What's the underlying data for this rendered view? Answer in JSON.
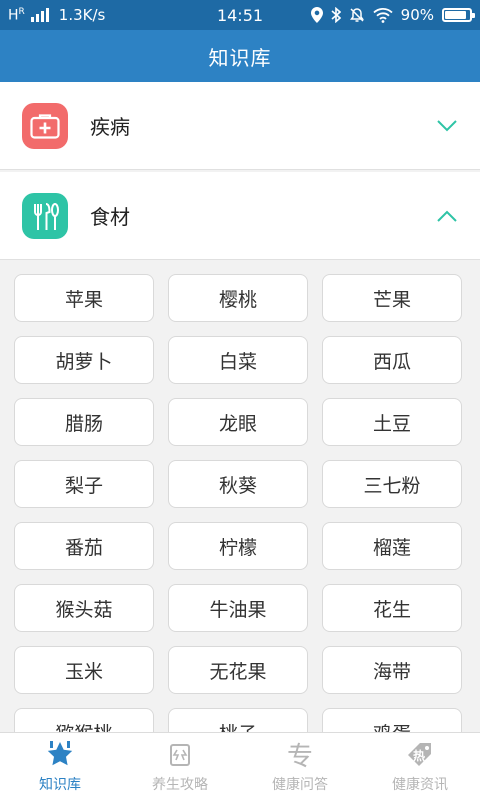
{
  "status_bar": {
    "network": "H",
    "network_sub": "R",
    "speed": "1.3K/s",
    "time": "14:51",
    "battery_percent": 90,
    "battery_label": "90%",
    "icons": [
      "location-icon",
      "bluetooth-icon",
      "mute-icon",
      "wifi-icon",
      "battery-icon"
    ]
  },
  "header": {
    "title": "知识库"
  },
  "categories": [
    {
      "label": "疾病",
      "icon": "first-aid-kit-icon",
      "color": "#f26b6b",
      "expanded": false
    },
    {
      "label": "食材",
      "icon": "fork-knife-icon",
      "color": "#2ec4a6",
      "expanded": true
    }
  ],
  "foods": [
    "苹果",
    "樱桃",
    "芒果",
    "胡萝卜",
    "白菜",
    "西瓜",
    "腊肠",
    "龙眼",
    "土豆",
    "梨子",
    "秋葵",
    "三七粉",
    "番茄",
    "柠檬",
    "榴莲",
    "猴头菇",
    "牛油果",
    "花生",
    "玉米",
    "无花果",
    "海带",
    "猕猴桃",
    "桃子",
    "鸡蛋"
  ],
  "tabs": [
    {
      "label": "知识库",
      "icon": "star-book-icon",
      "active": true
    },
    {
      "label": "养生攻略",
      "icon": "strategy-icon",
      "active": false
    },
    {
      "label": "健康问答",
      "icon": "zhuan-icon",
      "active": false,
      "glyph": "专"
    },
    {
      "label": "健康资讯",
      "icon": "hot-tag-icon",
      "active": false,
      "glyph": "热"
    }
  ],
  "colors": {
    "header": "#2d82c4",
    "status": "#1e6aa5",
    "accent": "#2ec4a6",
    "inactive": "#b5b5b5"
  }
}
